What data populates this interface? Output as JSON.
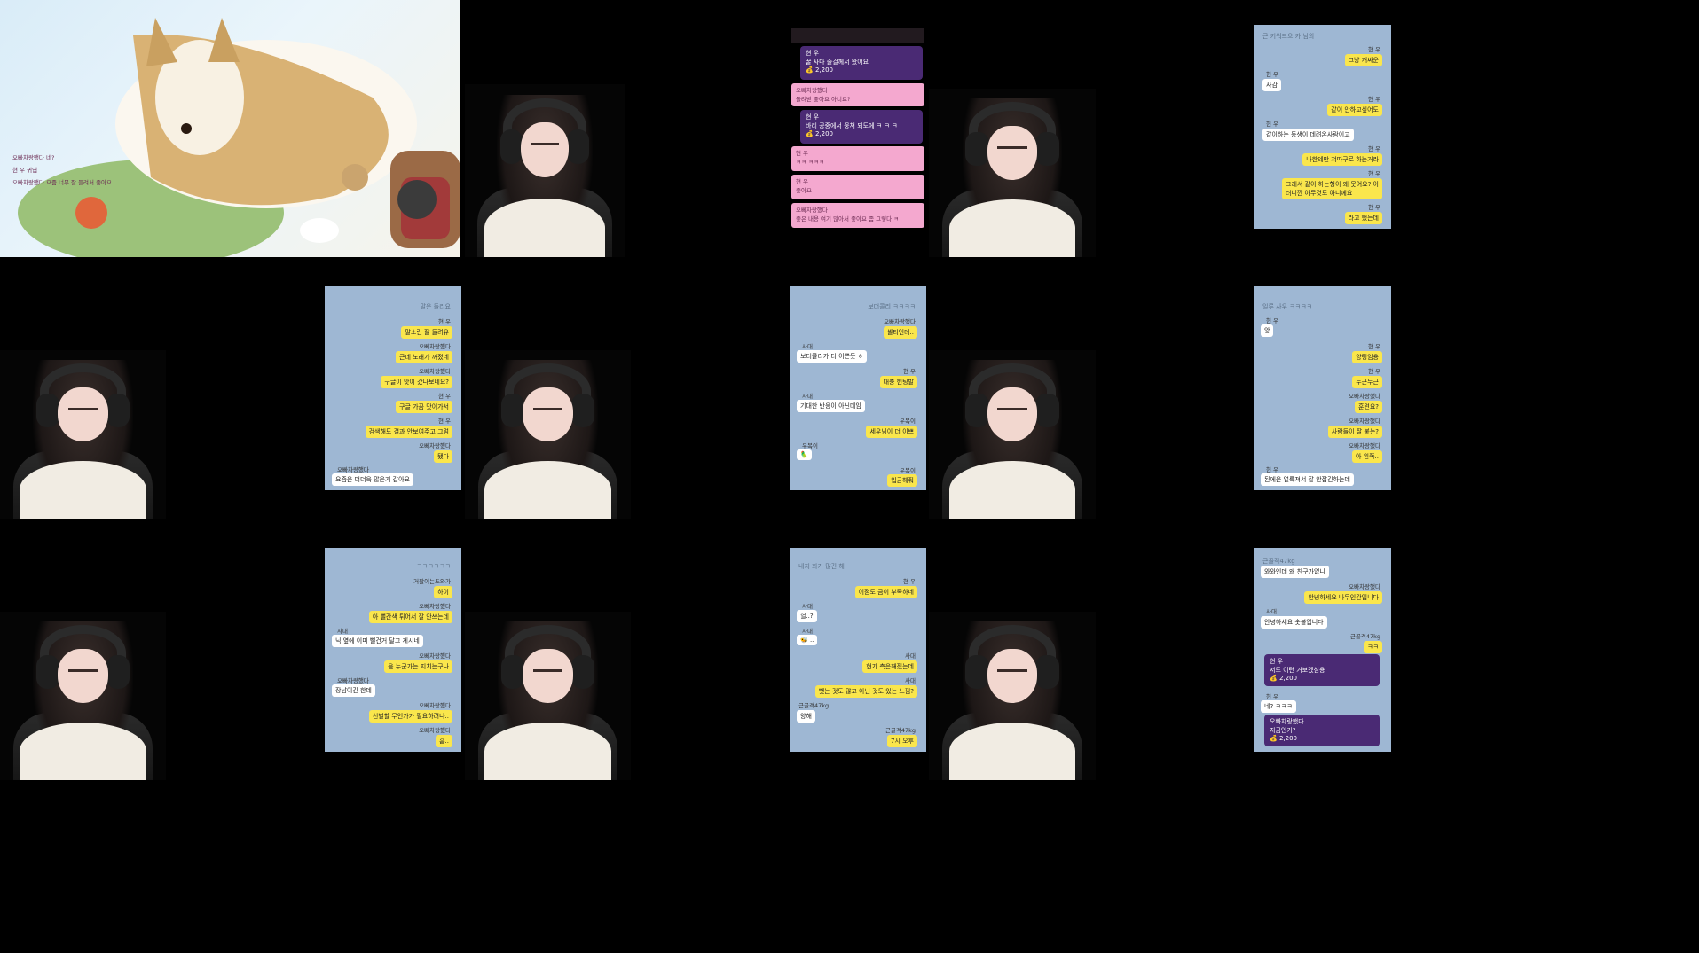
{
  "chat_overlay": {
    "lines": [
      {
        "user": "오빠차랑했다",
        "text": "네?"
      },
      {
        "user": "현 우",
        "text": "귀엽"
      },
      {
        "user": "오빠차랑했다",
        "text": "요즘 너무 잘 들려서 좋아요"
      }
    ]
  },
  "donation_chat": {
    "top_donation": {
      "user": "현 우",
      "text": "꿀 사다 줄걸께서 왔어요",
      "amount": "2,200"
    },
    "pink_1": {
      "user": "오빠차랑했다",
      "text": "돌려받 좋아요 아니요?"
    },
    "donation_2": {
      "user": "현 우",
      "text": "바리 공중에서 뭉쳐 되도에 ㅋ ㅋ ㅋ",
      "amount": "2,200"
    },
    "pink_2": {
      "user": "현 우",
      "text": "ㅋㅋ ㅋㅋㅋ"
    },
    "pink_3": {
      "user": "현 우",
      "text": "좋아요"
    },
    "pink_4": {
      "user": "오빠차랑했다",
      "text": "좋은 내용 여기 많아서 좋아요 좀 그렇다 ㅋ"
    }
  },
  "panel_top_right": {
    "header": "근 키워드으 카 님의",
    "items": [
      {
        "side": "right",
        "user": "현 우",
        "text": "그냥 개싸운"
      },
      {
        "side": "left",
        "user": "현 우",
        "text": "사감"
      },
      {
        "side": "right",
        "user": "현 우",
        "text": "같이 안하고싶어도"
      },
      {
        "side": "left",
        "user": "현 우",
        "text": "같이하는 동생이 데려온사람이고"
      },
      {
        "side": "right",
        "user": "현 우",
        "text": "나한테만 저따구로 하는거라"
      },
      {
        "side": "right",
        "user": "현 우",
        "text": "그래서 같이 하는형이 왜 뭇어요? 이러니깐 아무것도 아니에요"
      },
      {
        "side": "right",
        "user": "현 우",
        "text": "라고 했는데"
      }
    ]
  },
  "panel_mid_1": {
    "header": "말은 들리요",
    "items": [
      {
        "side": "right",
        "user": "현 우",
        "text": "말소린 잘 들려유"
      },
      {
        "side": "right",
        "user": "오빠차랑했다",
        "text": "근데 노래가 꺼졌네"
      },
      {
        "side": "right",
        "user": "오빠차랑했다",
        "text": "구글이 맛이 갔나보네요?"
      },
      {
        "side": "right",
        "user": "현 우",
        "text": "구글 가끔 맛이가서"
      },
      {
        "side": "right",
        "user": "현 우",
        "text": "검색해도 결과 안보여주고 그럼"
      },
      {
        "side": "right",
        "user": "오빠차랑했다",
        "text": "됐다"
      },
      {
        "side": "left",
        "user": "오빠차랑했다",
        "text": "요즘은 더더욱 많은거 같아요"
      }
    ]
  },
  "panel_mid_2": {
    "header": "보더콜리 ㅋㅋㅋㅋ",
    "items": [
      {
        "side": "right",
        "user": "오빠차랑했다",
        "text": "셸티인데.."
      },
      {
        "side": "left",
        "user": "사대",
        "text": "보더콜리가 더 이쁜듯 ㅎ"
      },
      {
        "side": "right",
        "user": "현 우",
        "text": "대충 헌팅발"
      },
      {
        "side": "left",
        "user": "사대",
        "text": "기대한 반응이 아닌데임"
      },
      {
        "side": "right",
        "user": "우복이",
        "text": "세우님이 더 이쁘"
      },
      {
        "side": "left",
        "user": "우복이",
        "text": "🦜"
      },
      {
        "side": "right",
        "user": "우복이",
        "text": "입금해줘"
      }
    ]
  },
  "panel_mid_3": {
    "header": "일루 사우 ㅋㅋㅋㅋ",
    "items": [
      {
        "side": "left",
        "user": "현 우",
        "text": "앙"
      },
      {
        "side": "right",
        "user": "현 우",
        "text": "앙팅임용"
      },
      {
        "side": "right",
        "user": "현 우",
        "text": "두근두근"
      },
      {
        "side": "right",
        "user": "오빠차랑했다",
        "text": "훈련요?"
      },
      {
        "side": "right",
        "user": "오빠차랑했다",
        "text": "사람들이 잘 붙는?"
      },
      {
        "side": "right",
        "user": "오빠차랑했다",
        "text": "아 왼쪽.."
      },
      {
        "side": "left",
        "user": "현 우",
        "text": "된에은 얼룩져서 잘 안잡긴하는데"
      }
    ]
  },
  "panel_bot_1": {
    "header": "ㅋㅋㅋㅋㅋㅋ",
    "items": [
      {
        "side": "right",
        "user": "거팔이는도와가",
        "text": "하이"
      },
      {
        "side": "right",
        "user": "오빠차랑했다",
        "text": "아 뻘간색 튀어서 잘 안쓰는데"
      },
      {
        "side": "left",
        "user": "사대",
        "text": "닉 옆에 이미 뻘건거 달고 계시네"
      },
      {
        "side": "right",
        "user": "오빠차랑했다",
        "text": "음 누군가는 지치는구나"
      },
      {
        "side": "left",
        "user": "오빠차랑했다",
        "text": "장남이긴 한데"
      },
      {
        "side": "right",
        "user": "오빠차랑했다",
        "text": "선별할 무언가가 필요하려나.."
      },
      {
        "side": "right",
        "user": "오빠차랑했다",
        "text": "흠.."
      }
    ]
  },
  "panel_bot_2": {
    "header": "내지 화가 많긴 해",
    "items": [
      {
        "side": "right",
        "user": "현 우",
        "text": "이점도 금이 부족하네"
      },
      {
        "side": "left",
        "user": "사대",
        "text": "헐..?"
      },
      {
        "side": "left",
        "user": "사대",
        "text": "🐝 .."
      },
      {
        "side": "right",
        "user": "사대",
        "text": "현가 측은해졌는데"
      },
      {
        "side": "right",
        "user": "사대",
        "text": "뺏는 것도 많고 아닌 것도 있는 느낌?"
      },
      {
        "side": "left",
        "user": "근골격47kg",
        "text": "양해"
      },
      {
        "side": "right",
        "user": "근골격47kg",
        "text": "7시 오후"
      }
    ]
  },
  "panel_bot_3": {
    "header": "근골격47kg",
    "items": [
      {
        "side": "left",
        "user": "",
        "text": "와와인데 왜 친구가없니"
      },
      {
        "side": "right",
        "user": "오빠차랑했다",
        "text": "안녕하세요 나무인간입니다"
      },
      {
        "side": "left",
        "user": "사대",
        "text": "안녕하세요 숫불입니다"
      },
      {
        "side": "right",
        "user": "근골격47kg",
        "text": "ㅋㅋ"
      }
    ],
    "donation_1": {
      "user": "현 우",
      "text": "저도 이런 거보겠심용",
      "amount": "2,200"
    },
    "reply": {
      "user": "현 우",
      "text": "네? ㅋㅋㅋ"
    },
    "donation_2": {
      "user": "오빠차랑했다",
      "text": "지금인가?",
      "amount": "2,200"
    }
  },
  "colors": {
    "kakao_bg": "#9eb7d3",
    "kakao_yellow": "#fae64c",
    "donation_purple": "#4a2a74",
    "pink_chat": "#f4a8cf"
  }
}
